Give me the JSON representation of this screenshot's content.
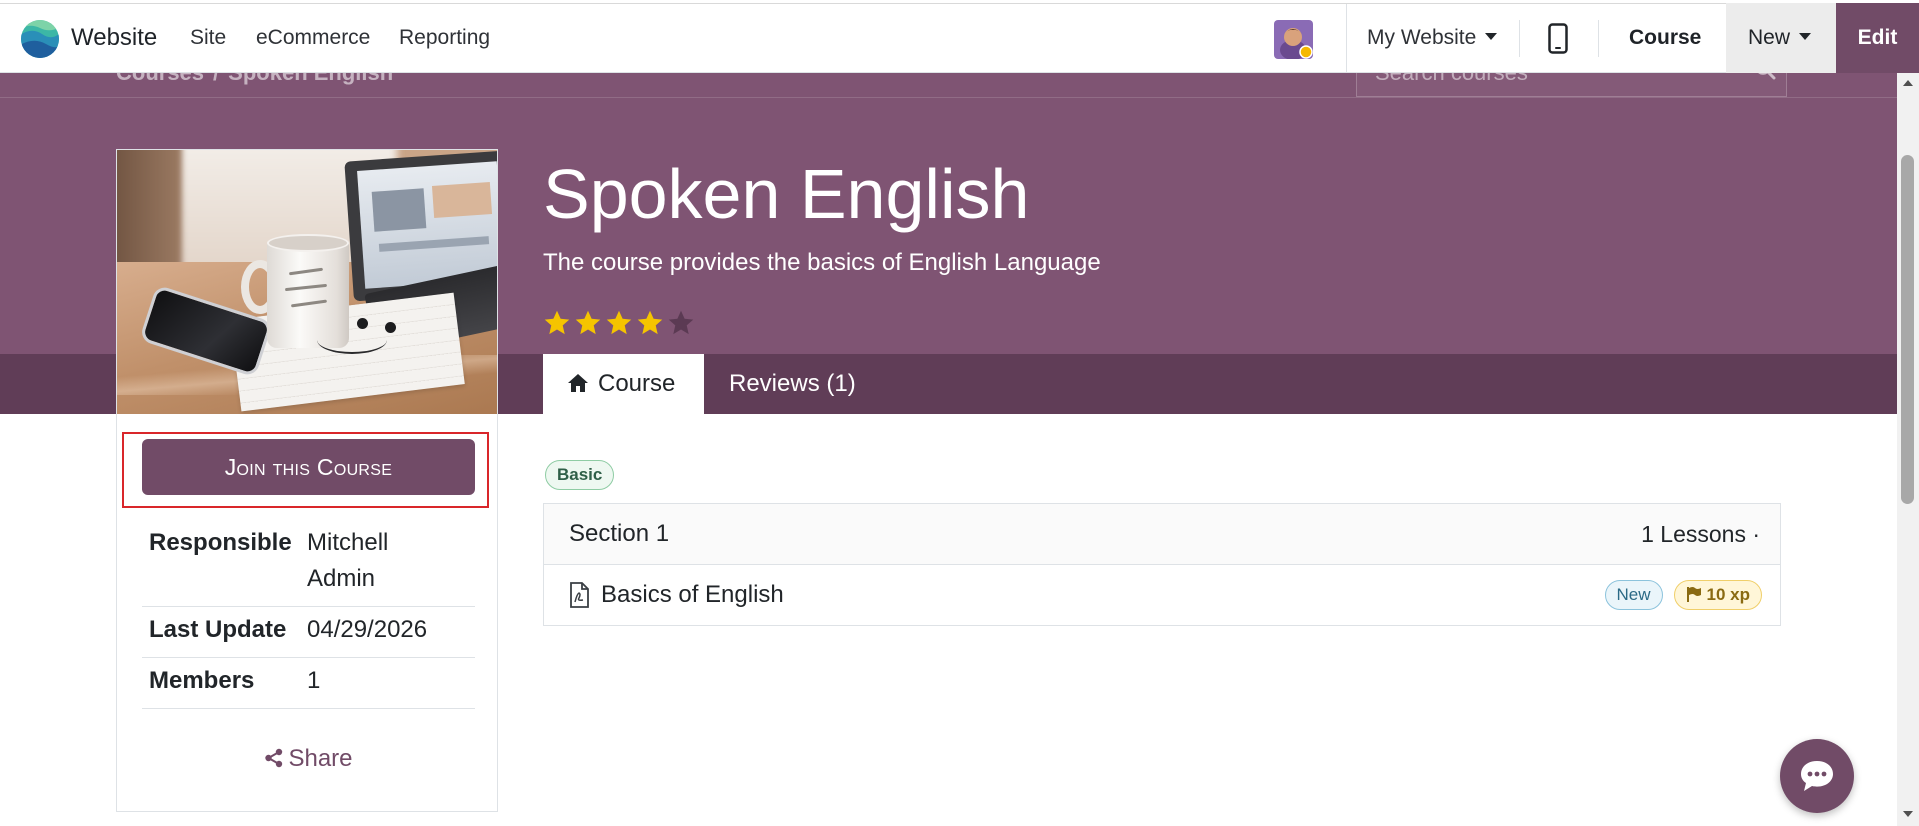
{
  "navbar": {
    "brand": "Website",
    "menu": [
      "Site",
      "eCommerce",
      "Reporting"
    ],
    "website_selector": "My Website",
    "course_label": "Course",
    "new_label": "New",
    "edit_label": "Edit"
  },
  "breadcrumb": {
    "root": "Courses",
    "separator": "/",
    "current": "Spoken English"
  },
  "search": {
    "placeholder": "Search courses"
  },
  "course": {
    "title": "Spoken English",
    "subtitle": "The course provides the basics of English Language",
    "rating": 4,
    "rating_max": 5,
    "tabs": [
      {
        "label": "Course",
        "icon": "home-icon",
        "active": true
      },
      {
        "label": "Reviews (1)",
        "active": false
      }
    ],
    "join_label": "Join this Course",
    "info": [
      {
        "label": "Responsible",
        "value": "Mitchell Admin"
      },
      {
        "label": "Last Update",
        "value": "04/29/2026"
      },
      {
        "label": "Members",
        "value": "1"
      }
    ],
    "share_label": "Share",
    "tags": [
      "Basic"
    ],
    "sections": [
      {
        "title": "Section 1",
        "meta": "1 Lessons ·",
        "lessons": [
          {
            "title": "Basics of English",
            "icon": "pdf-file-icon",
            "badge": "New",
            "xp": "10 xp"
          }
        ]
      }
    ]
  },
  "icons": {
    "brand": "website-logo-icon",
    "device_preview": "mobile-phone-icon",
    "search": "search-icon",
    "share": "share-icon",
    "xp": "flag-icon",
    "chat": "chat-icon"
  },
  "colors": {
    "accent": "#714b67",
    "hero": "#7f5473",
    "hero_dark": "#603d57",
    "star_filled": "#f5c400",
    "star_empty": "#5b3a53",
    "highlight": "#d9262a"
  }
}
